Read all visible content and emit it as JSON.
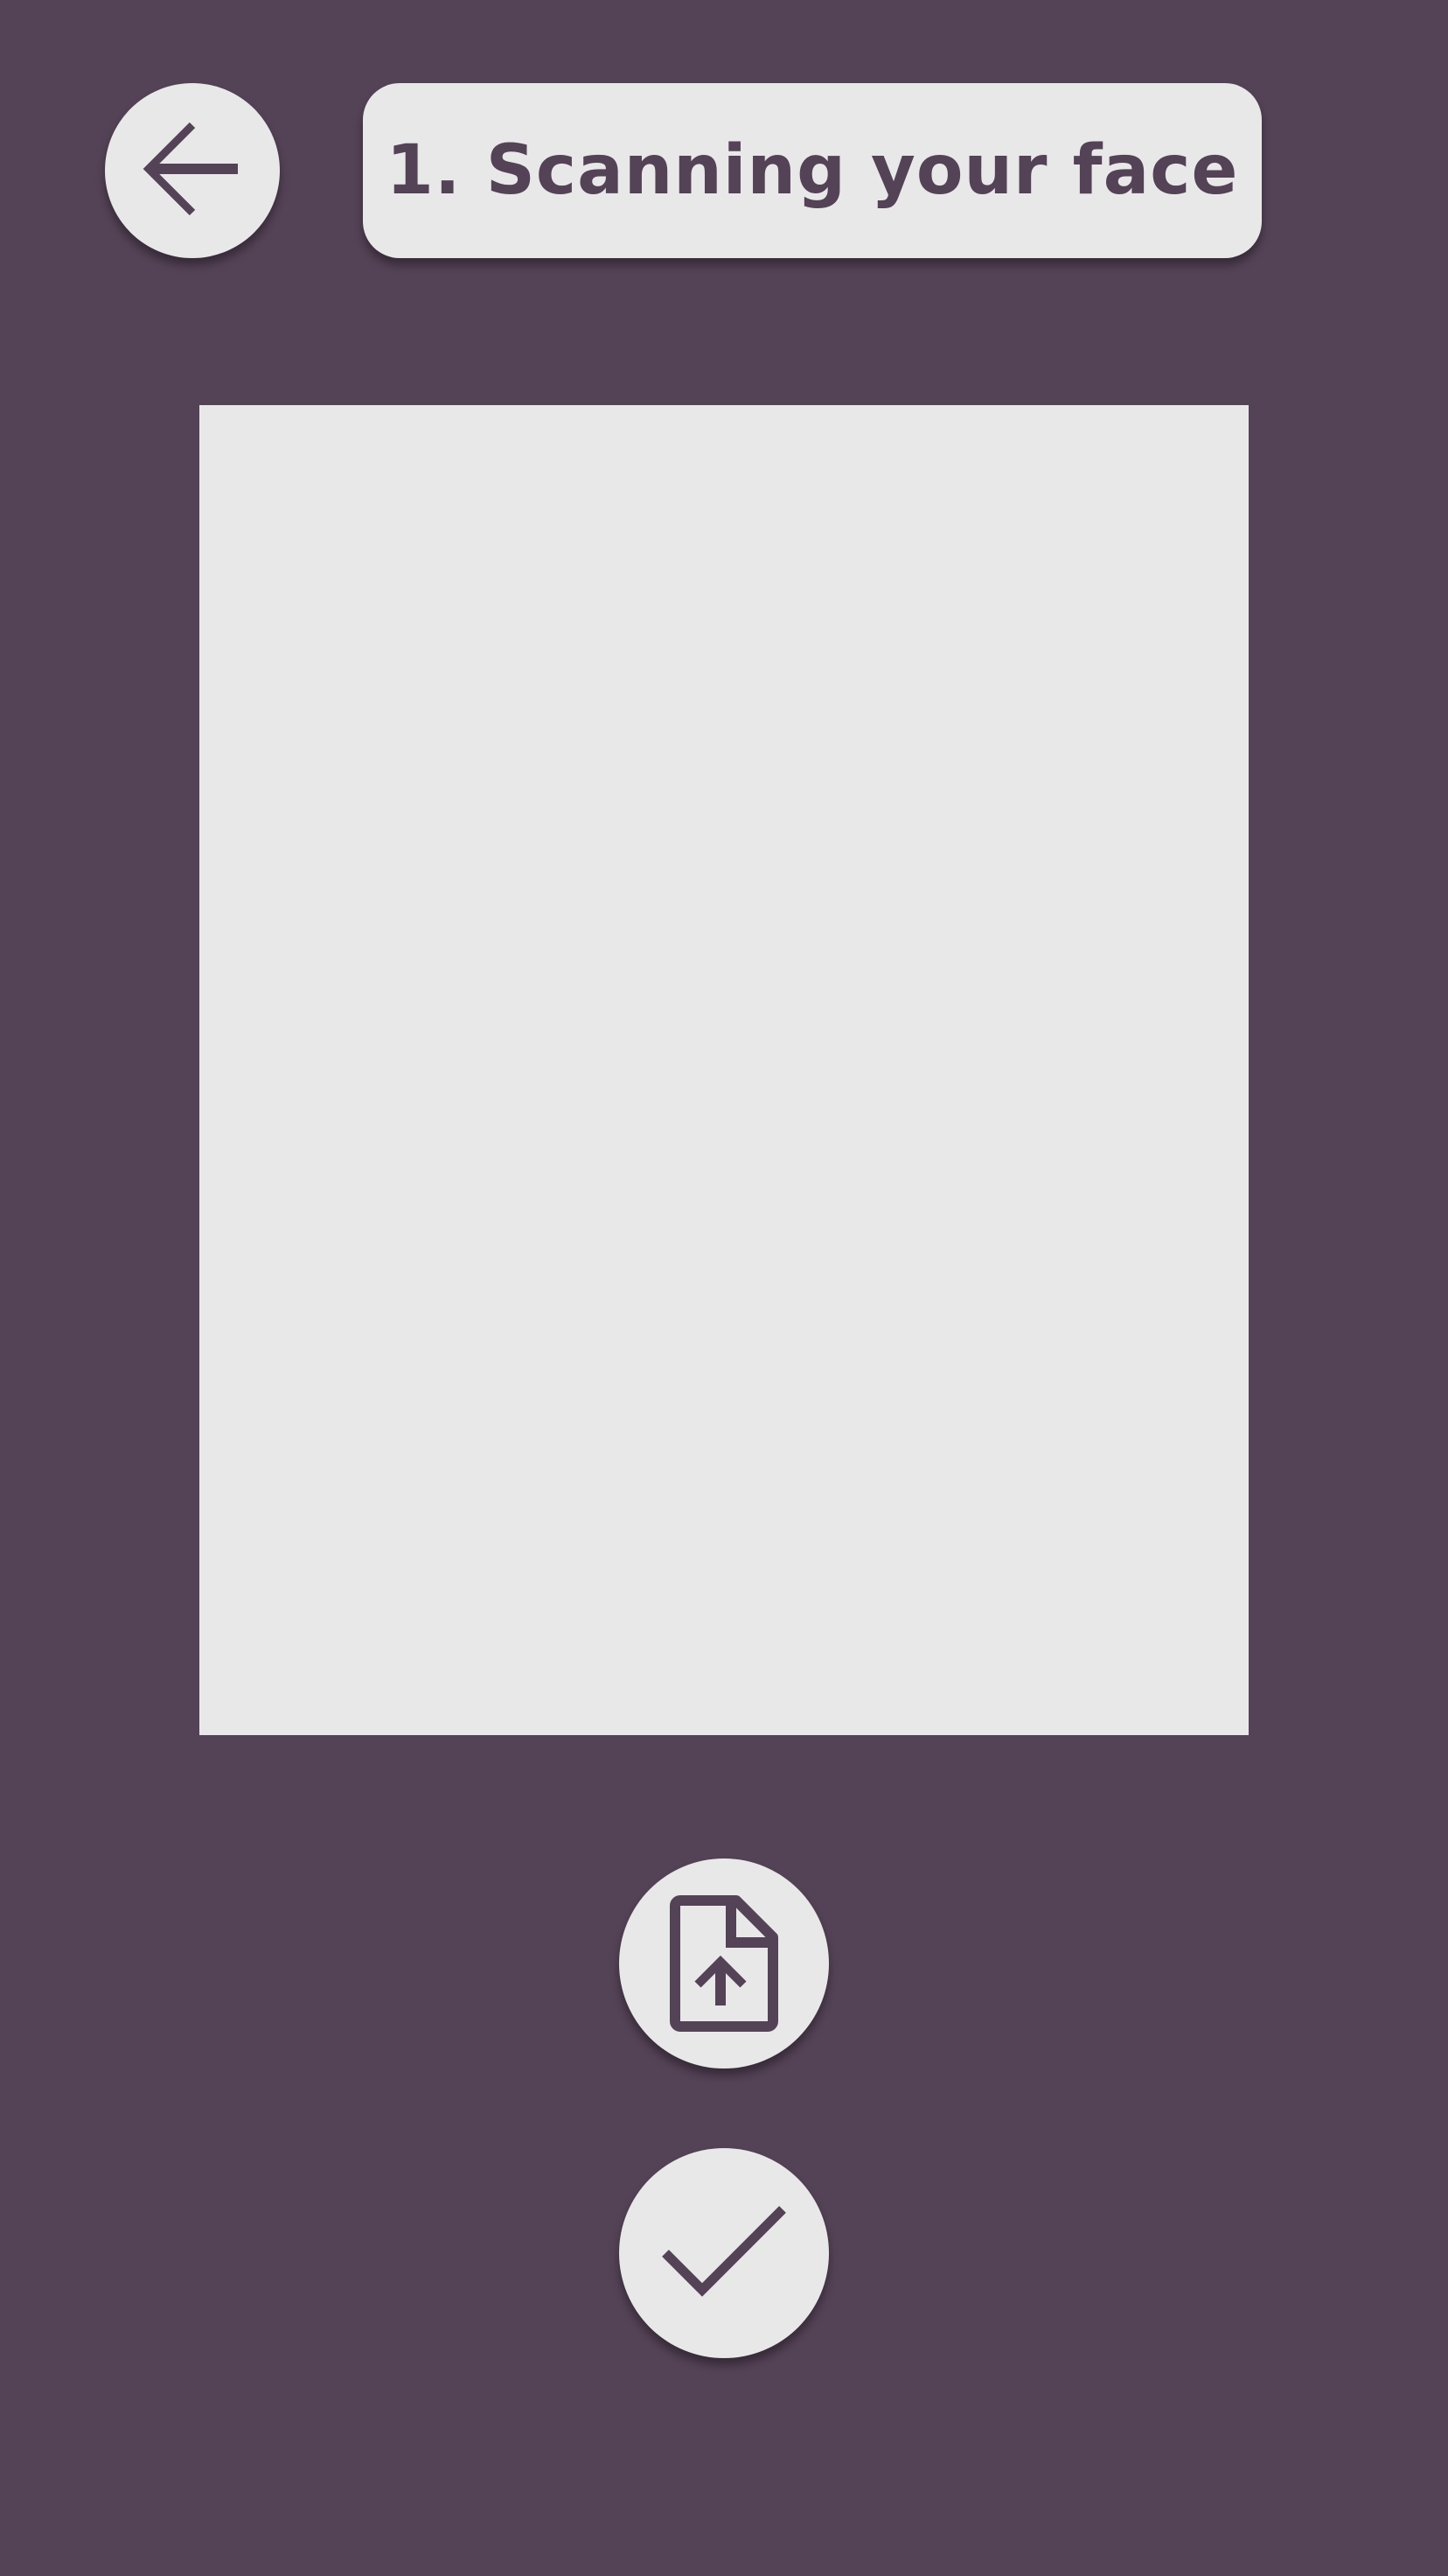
{
  "header": {
    "title": "1. Scanning your face",
    "back_icon": "arrow-left-icon"
  },
  "actions": {
    "upload_icon": "file-upload-icon",
    "confirm_icon": "checkmark-icon"
  },
  "colors": {
    "background": "#544256",
    "surface": "#e8e8e8",
    "accent": "#544256"
  }
}
